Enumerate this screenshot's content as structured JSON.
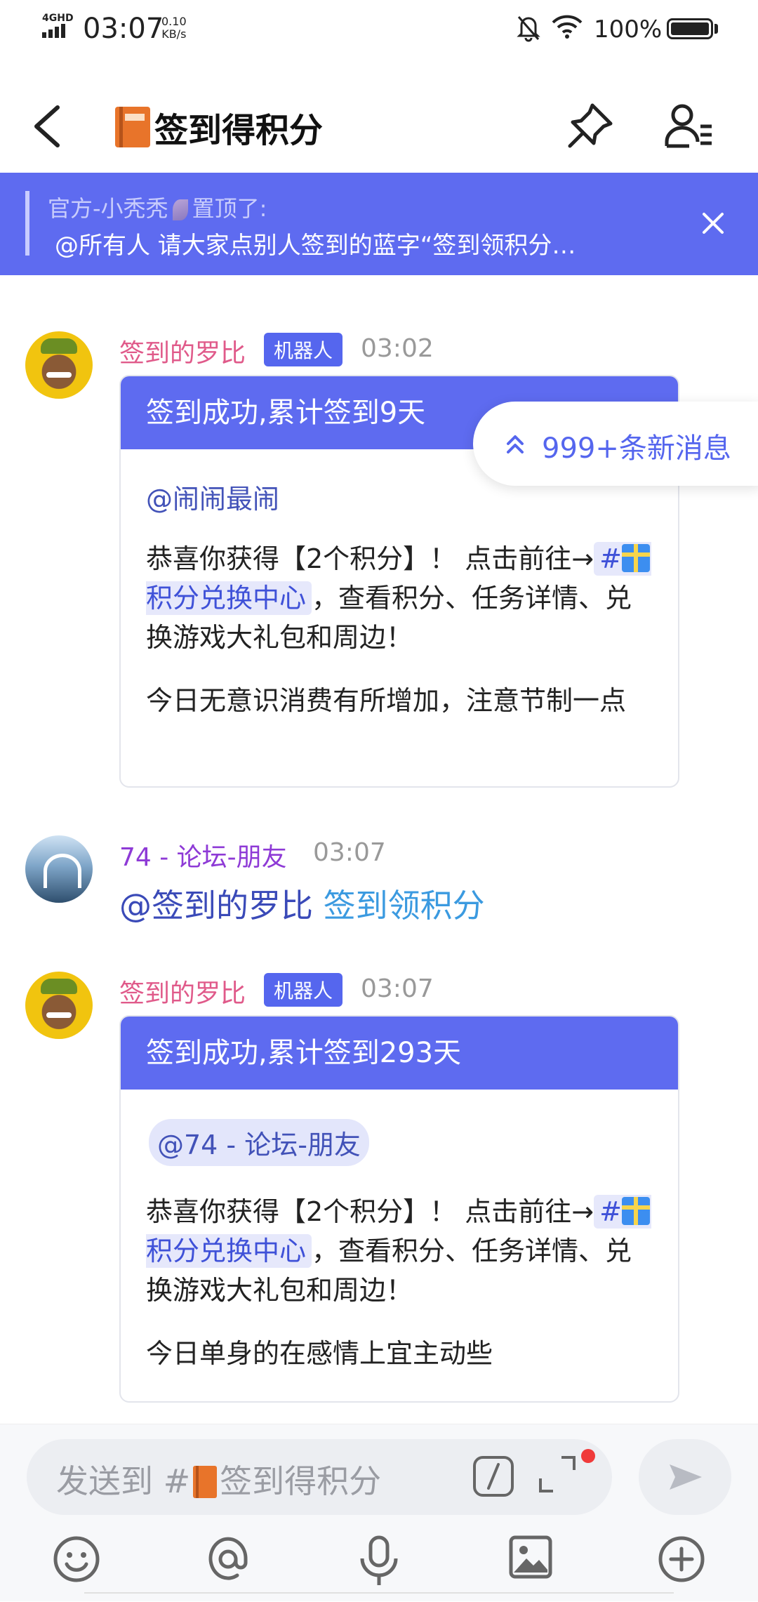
{
  "status_bar": {
    "network": "4GHD",
    "time": "03:07",
    "speed_value": "0.10",
    "speed_unit": "KB/s",
    "battery": "100%"
  },
  "header": {
    "title": "签到得积分",
    "title_emoji": "orange-book-emoji"
  },
  "pinned": {
    "author": "官方-小秃秃",
    "action": "置顶了:",
    "text": "@所有人 请大家点别人签到的蓝字“签到领积分…"
  },
  "new_messages": {
    "label": "999+条新消息"
  },
  "messages": [
    {
      "sender": "签到的罗比",
      "badge": "机器人",
      "time": "03:02",
      "card": {
        "title": "签到成功,累计签到9天",
        "mention": "@闹闹最闹",
        "line_prefix": "恭喜你获得【2个积分】！ 点击前往→",
        "channel_prefix": "#",
        "channel": "积分兑换中心",
        "line_suffix": "，查看积分、任务详情、兑换游戏大礼包和周边！",
        "fortune": "今日无意识消费有所增加，注意节制一点"
      }
    },
    {
      "sender": "74 - 论坛-朋友",
      "time": "03:07",
      "mention": "@签到的罗比",
      "link": "签到领积分"
    },
    {
      "sender": "签到的罗比",
      "badge": "机器人",
      "time": "03:07",
      "card": {
        "title": "签到成功,累计签到293天",
        "mention": "@74 - 论坛-朋友",
        "line_prefix": "恭喜你获得【2个积分】！ 点击前往→",
        "channel_prefix": "#",
        "channel": "积分兑换中心",
        "line_suffix": "，查看积分、任务详情、兑换游戏大礼包和周边！",
        "fortune": "今日单身的在感情上宜主动些"
      }
    }
  ],
  "composer": {
    "placeholder_prefix": "发送到 #",
    "placeholder_channel": "签到得积分"
  },
  "colors": {
    "accent": "#5e6bf0",
    "bot_sender": "#e05a8a",
    "user_sender": "#8e3ad6",
    "link": "#3b9ae0"
  }
}
